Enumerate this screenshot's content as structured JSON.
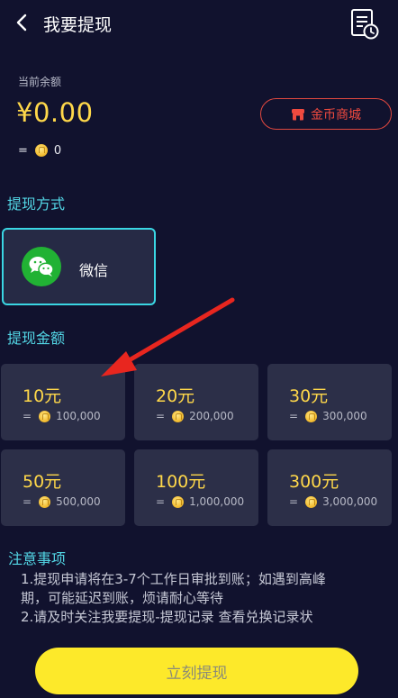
{
  "header": {
    "title": "我要提现",
    "back_icon": "chevron-left-icon",
    "record_icon": "document-clock-icon"
  },
  "balance": {
    "label": "当前余额",
    "value": "¥0.00",
    "coin_eq": "=",
    "coin_value": "0"
  },
  "mall_button": {
    "label": "金币商城",
    "icon": "shop-icon",
    "color": "#ef4a3f"
  },
  "method_section": {
    "title": "提现方式",
    "methods": [
      {
        "label": "微信",
        "icon": "wechat-icon",
        "selected": true
      }
    ]
  },
  "amount_section": {
    "title": "提现金额",
    "options": [
      {
        "amount": "10元",
        "eq": "=",
        "coins": "100,000"
      },
      {
        "amount": "20元",
        "eq": "=",
        "coins": "200,000"
      },
      {
        "amount": "30元",
        "eq": "=",
        "coins": "300,000"
      },
      {
        "amount": "50元",
        "eq": "=",
        "coins": "500,000"
      },
      {
        "amount": "100元",
        "eq": "=",
        "coins": "1,000,000"
      },
      {
        "amount": "300元",
        "eq": "=",
        "coins": "3,000,000"
      }
    ]
  },
  "notes": {
    "title": "注意事项",
    "lines": [
      "1.提现申请将在3-7个工作日审批到账；如遇到高峰",
      "期，可能延迟到账，烦请耐心等待",
      "2.请及时关注我要提现-提现记录 查看兑换记录状"
    ]
  },
  "submit_button": {
    "label": "立刻提现"
  },
  "colors": {
    "background": "#11122e",
    "accent": "#53d7e6",
    "gold": "#ffd84a",
    "button": "#fde92a",
    "arrow": "#e8261f"
  }
}
